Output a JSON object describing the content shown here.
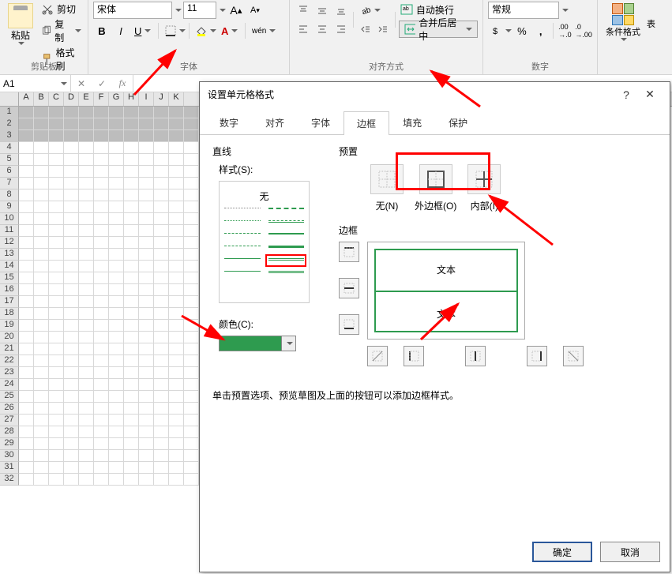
{
  "ribbon": {
    "clipboard": {
      "label": "剪贴板",
      "paste": "粘贴",
      "cut": "剪切",
      "copy": "复制",
      "format_painter": "格式刷"
    },
    "font": {
      "label": "字体",
      "name": "宋体",
      "size": "11",
      "grow": "A",
      "shrink": "A",
      "bold": "B",
      "italic": "I",
      "underline": "U",
      "wen": "wén"
    },
    "alignment": {
      "label": "对齐方式",
      "wrap": "自动换行",
      "merge": "合并后居中"
    },
    "number": {
      "label": "数字",
      "format": "常规"
    },
    "styles": {
      "cond_format": "条件格式",
      "table_fmt": "表"
    }
  },
  "formula_bar": {
    "name_box": "A1",
    "fx": "fx"
  },
  "sheet": {
    "cols": [
      "A",
      "B",
      "C",
      "D",
      "E",
      "F",
      "G",
      "H",
      "I",
      "J",
      "K"
    ],
    "rows": [
      "1",
      "2",
      "3",
      "4",
      "5",
      "6",
      "7",
      "8",
      "9",
      "10",
      "11",
      "12",
      "13",
      "14",
      "15",
      "16",
      "17",
      "18",
      "19",
      "20",
      "21",
      "22",
      "23",
      "24",
      "25",
      "26",
      "27",
      "28",
      "29",
      "30",
      "31",
      "32"
    ]
  },
  "dialog": {
    "title": "设置单元格格式",
    "help": "?",
    "tabs": [
      "数字",
      "对齐",
      "字体",
      "边框",
      "填充",
      "保护"
    ],
    "active_tab": "边框",
    "line_section": "直线",
    "style_label": "样式(S):",
    "none": "无",
    "color_label": "颜色(C):",
    "preset_section": "预置",
    "presets": {
      "none": "无(N)",
      "outline": "外边框(O)",
      "inside": "内部(I)"
    },
    "border_section": "边框",
    "preview_text": "文本",
    "hint": "单击预置选项、预览草图及上面的按钮可以添加边框样式。",
    "ok": "确定",
    "cancel": "取消",
    "selected_color": "#2e9b4f"
  }
}
